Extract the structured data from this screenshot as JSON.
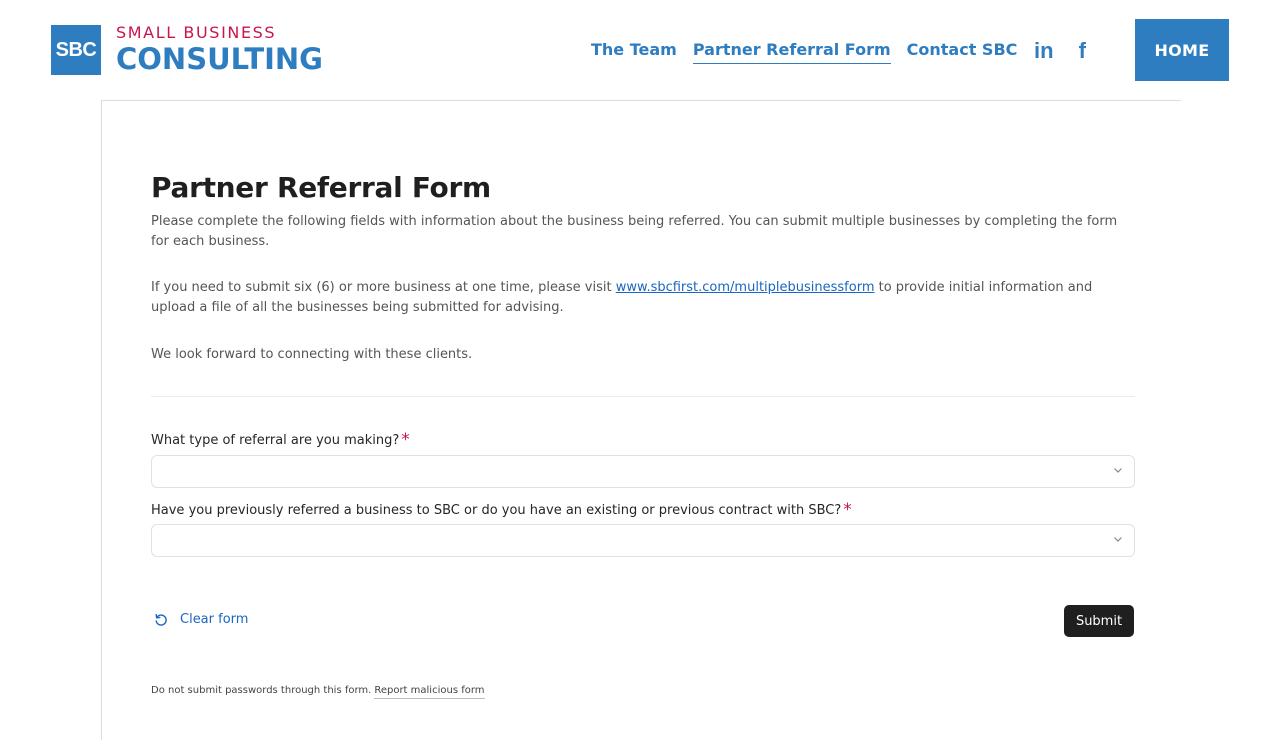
{
  "header": {
    "logo": {
      "box": "SBC",
      "small": "SMALL BUSINESS",
      "big": "CONSULTING"
    },
    "nav": [
      {
        "label": "The Team"
      },
      {
        "label": "Partner Referral Form"
      },
      {
        "label": "Contact SBC"
      }
    ],
    "social": {
      "linkedin": "in",
      "facebook": "f"
    },
    "home_label": "HOME"
  },
  "form": {
    "title": "Partner Referral Form",
    "intro": "Please complete the following fields with information about the business being referred. You can submit multiple businesses by completing the form for each business.",
    "multi_before": "If you need to submit six (6) or more business at one time, please visit ",
    "multi_link": "www.sbcfirst.com/multiplebusinessform",
    "multi_after": " to provide initial information and upload a file of all the businesses being submitted for advising.",
    "closing": "We look forward to connecting with these clients.",
    "questions": [
      {
        "label": "What type of referral are you making?",
        "required": "*",
        "value": ""
      },
      {
        "label": "Have you previously referred a business to SBC or do you have an existing or previous contract with SBC?",
        "required": "*",
        "value": ""
      }
    ],
    "clear_label": "Clear form",
    "submit_label": "Submit",
    "footer_note": "Do not submit passwords through this form.",
    "report_label": "Report malicious form"
  },
  "colors": {
    "brand_blue": "#2d7dc0",
    "brand_red": "#c8164b",
    "submit_bg": "#1f1f1f"
  }
}
